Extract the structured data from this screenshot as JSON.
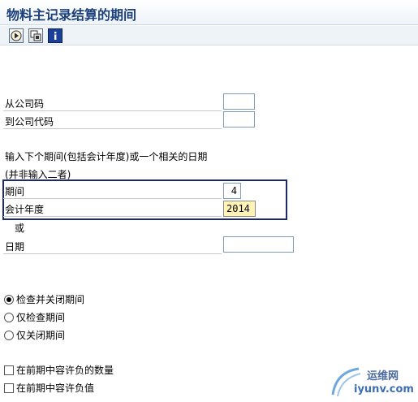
{
  "window": {
    "title": "物料主记录结算的期间"
  },
  "toolbar": {
    "buttons": [
      {
        "icon": "execute-icon"
      },
      {
        "icon": "variant-icon"
      },
      {
        "icon": "info-icon"
      }
    ]
  },
  "company": {
    "from_label": "从公司码",
    "from_value": "",
    "to_label": "到公司代码",
    "to_value": ""
  },
  "hint": {
    "line1": "输入下个期间(包括会计年度)或一个相关的日期",
    "line2": "(并非输入二者)"
  },
  "period": {
    "label": "期间",
    "value": "4",
    "year_label": "会计年度",
    "year_value": "2014"
  },
  "or_label": "或",
  "date": {
    "label": "日期",
    "value": ""
  },
  "options": [
    {
      "label": "检查并关闭期间",
      "selected": true
    },
    {
      "label": "仅检查期间",
      "selected": false
    },
    {
      "label": "仅关闭期间",
      "selected": false
    }
  ],
  "checkboxes": [
    {
      "label": "在前期中容许负的数量",
      "checked": false
    },
    {
      "label": "在前期中容许负值",
      "checked": false
    }
  ],
  "watermark": {
    "text1": "运维网",
    "text2": "iyunv.com"
  }
}
